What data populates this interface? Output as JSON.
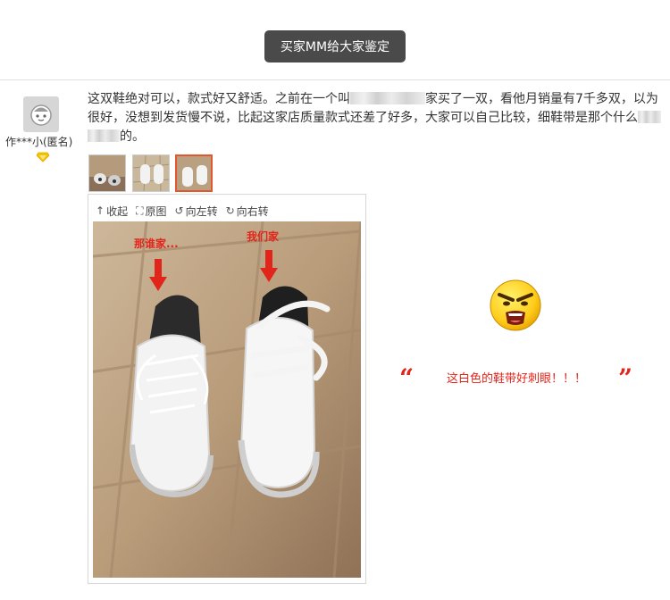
{
  "banner": {
    "label": "买家MM给大家鉴定"
  },
  "reviewer": {
    "name": "作***小(匿名)",
    "avatar_icon": "avatar-face-icon",
    "badge_icon": "diamond-icon",
    "badge_color": "#f5c400"
  },
  "review": {
    "line1_a": "这双鞋绝对可以，款式好又舒适。之前在一个叫",
    "line1_b": "家买了一双，看他月销量有7千多双，以为",
    "line2_a": "很好，没想到发货慢不说，比起这家店质量款式还差了好多，大家可以自己比较，细鞋带是那个什么",
    "line3_b": "的。"
  },
  "thumbnails": {
    "count": 3,
    "selected_index": 2
  },
  "viewer": {
    "tools": [
      {
        "icon": "collapse-icon",
        "glyph": "↑",
        "label": "收起"
      },
      {
        "icon": "fullsize-icon",
        "glyph": "⛶",
        "label": "原图"
      },
      {
        "icon": "rotate-left-icon",
        "glyph": "↺",
        "label": "向左转"
      },
      {
        "icon": "rotate-right-icon",
        "glyph": "↻",
        "label": "向右转"
      }
    ],
    "photo_labels": {
      "left": "那谁家...",
      "right": "我们家"
    }
  },
  "comment": {
    "open_quote": "“",
    "text": "这白色的鞋带好刺眼！！！",
    "close_quote": "”",
    "emoji_icon": "angry-emoji-icon"
  },
  "colors": {
    "accent_red": "#e1251b",
    "banner_bg": "#4a4a4a",
    "selected_border": "#e4572e"
  }
}
